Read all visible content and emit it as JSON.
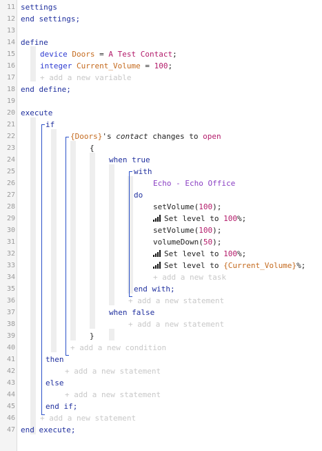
{
  "line_numbers": [
    "11",
    "12",
    "13",
    "14",
    "15",
    "16",
    "17",
    "18",
    "19",
    "20",
    "21",
    "22",
    "23",
    "24",
    "25",
    "26",
    "27",
    "28",
    "29",
    "30",
    "31",
    "32",
    "33",
    "34",
    "35",
    "36",
    "37",
    "38",
    "39",
    "40",
    "41",
    "42",
    "43",
    "44",
    "45",
    "46",
    "47"
  ],
  "settings": {
    "open": "settings",
    "close": "end settings;"
  },
  "define": {
    "open": "define",
    "device_type": "device",
    "device_name": "Doors",
    "device_eq": " = ",
    "device_value": "A Test Contact",
    "int_type": "integer",
    "int_name": "Current_Volume",
    "int_eq": " = ",
    "int_value": "100",
    "add_variable": "+ add a new variable",
    "close": "end define;"
  },
  "execute": {
    "open": "execute",
    "if": "if",
    "cond_device": "{Doors}",
    "cond_possessive": "'s ",
    "cond_attr": "contact",
    "cond_changes": " changes to ",
    "cond_value": "open",
    "open_brace": "{",
    "when_true": "when true",
    "with": "with",
    "with_device": "Echo - Echo Office",
    "do": "do",
    "tasks": {
      "setvol1_fn": "setVolume(",
      "setvol1_arg": "100",
      "setvol1_end": ");",
      "level1_text": "Set level to ",
      "level1_value": "100",
      "level1_end": "%;",
      "setvol2_fn": "setVolume(",
      "setvol2_arg": "100",
      "setvol2_end": ");",
      "voldown_fn": "volumeDown(",
      "voldown_arg": "50",
      "voldown_end": ");",
      "level2_text": "Set level to ",
      "level2_value": "100",
      "level2_end": "%;",
      "level3_text": "Set level to ",
      "level3_value": "{Current_Volume}",
      "level3_end": "%;"
    },
    "add_task": "+ add a new task",
    "end_with": "end with;",
    "add_statement_1": "+ add a new statement",
    "when_false": "when false",
    "add_statement_2": "+ add a new statement",
    "close_brace": "}",
    "add_condition": "+ add a new condition",
    "then": "then",
    "add_statement_3": "+ add a new statement",
    "else": "else",
    "add_statement_4": "+ add a new statement",
    "end_if": "end if;",
    "add_statement_5": "+ add a new statement",
    "close": "end execute;"
  }
}
